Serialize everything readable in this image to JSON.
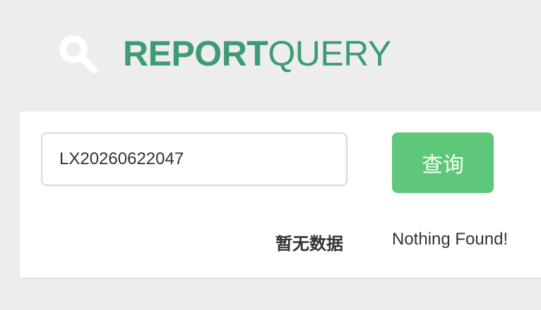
{
  "header": {
    "brand_strong": "REPORT",
    "brand_light": "QUERY",
    "icon": "search-icon",
    "accent_color": "#3f9b74"
  },
  "query": {
    "input_value": "LX20260622047",
    "button_label": "查询",
    "button_color": "#5fc779"
  },
  "result": {
    "no_data_cn": "暂无数据",
    "no_data_en": "Nothing Found!"
  }
}
